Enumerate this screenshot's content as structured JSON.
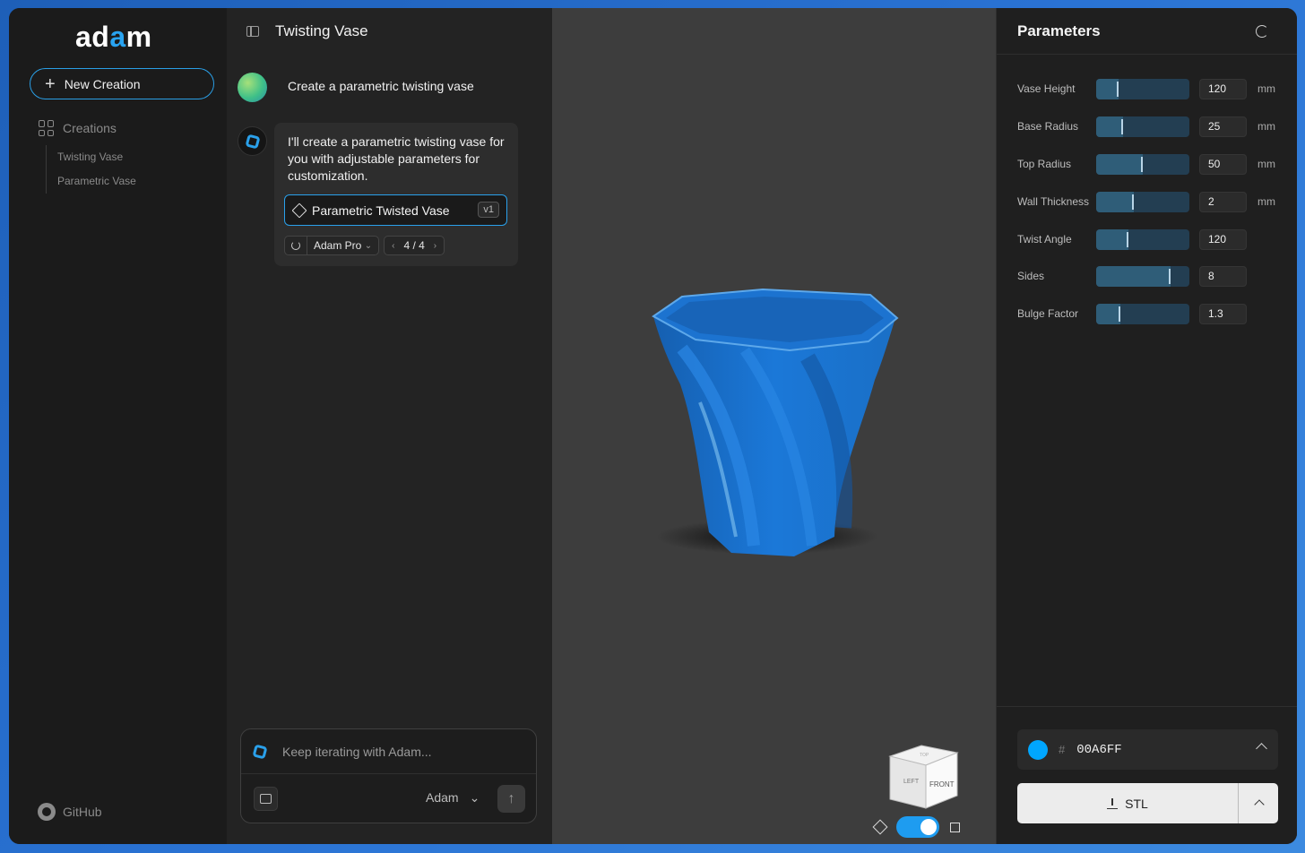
{
  "sidebar": {
    "logo_pre": "ad",
    "logo_accent": "a",
    "logo_post": "m",
    "new_button": "New Creation",
    "creations_heading": "Creations",
    "creations": [
      "Twisting Vase",
      "Parametric Vase"
    ],
    "github_label": "GitHub"
  },
  "chat": {
    "title": "Twisting Vase",
    "user_message": "Create a parametric twisting vase",
    "bot_message": "I'll create a parametric twisting vase for you with adjustable parameters for customization.",
    "artifact_title": "Parametric Twisted Vase",
    "artifact_version": "v1",
    "model_chip": "Adam Pro",
    "pager": "4 / 4",
    "input_placeholder": "Keep iterating with Adam...",
    "model_select": "Adam"
  },
  "viewport": {
    "viewcube_front": "FRONT",
    "viewcube_left": "LEFT",
    "viewcube_top": "TOP",
    "model_color": "#1a78d6",
    "toggle_on": true
  },
  "parameters": {
    "title": "Parameters",
    "items": [
      {
        "label": "Vase Height",
        "value": "120",
        "unit": "mm",
        "fraction": 0.24
      },
      {
        "label": "Base Radius",
        "value": "25",
        "unit": "mm",
        "fraction": 0.29
      },
      {
        "label": "Top Radius",
        "value": "50",
        "unit": "mm",
        "fraction": 0.5
      },
      {
        "label": "Wall Thickness",
        "value": "2",
        "unit": "mm",
        "fraction": 0.4
      },
      {
        "label": "Twist Angle",
        "value": "120",
        "unit": "",
        "fraction": 0.35
      },
      {
        "label": "Sides",
        "value": "8",
        "unit": "",
        "fraction": 0.8
      },
      {
        "label": "Bulge Factor",
        "value": "1.3",
        "unit": "",
        "fraction": 0.26
      }
    ],
    "color_hash": "#",
    "color_hex": "00A6FF",
    "color_value": "#00a6ff",
    "export_label": "STL"
  }
}
